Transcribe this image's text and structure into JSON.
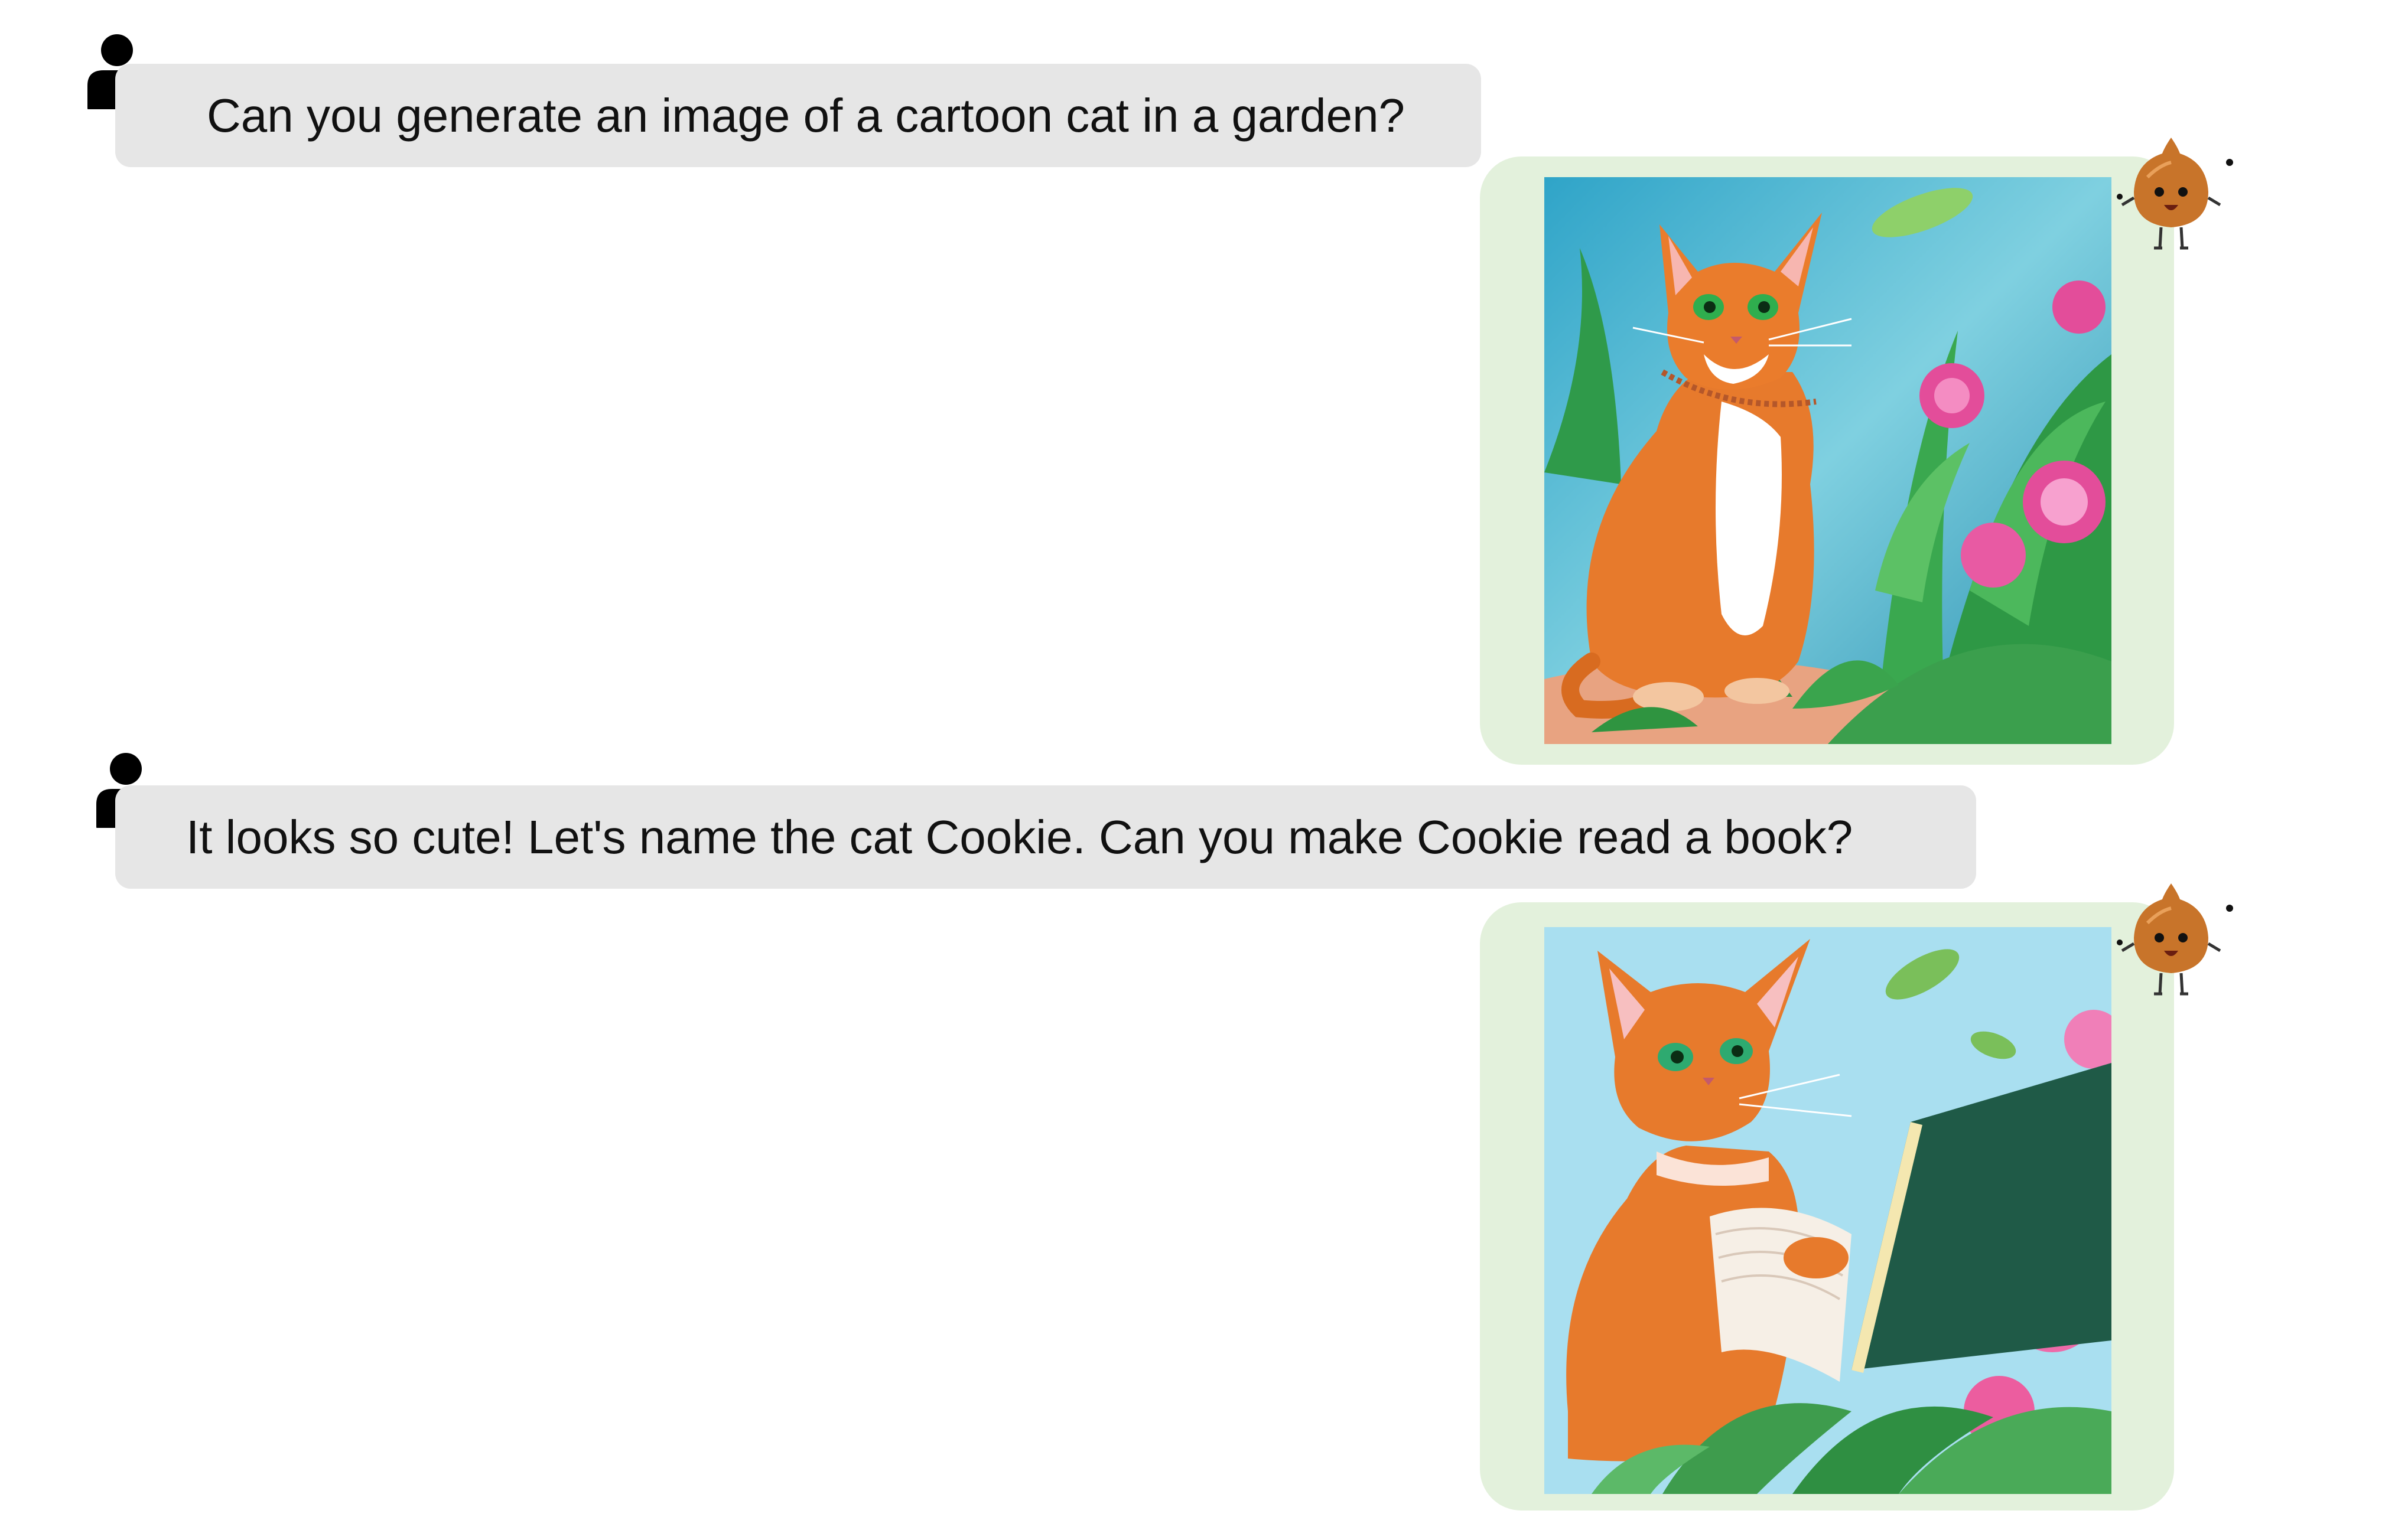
{
  "conversation": {
    "turns": [
      {
        "role": "user",
        "icon": "user-icon",
        "text": "Can you generate an image of a cartoon cat in a garden?"
      },
      {
        "role": "assistant",
        "icon": "chestnut-mascot-icon",
        "image": "orange cartoon cat sitting among green plants and pink flowers"
      },
      {
        "role": "user",
        "icon": "user-icon",
        "text": "It looks so cute! Let's name the cat Cookie. Can you make Cookie read a book?"
      },
      {
        "role": "assistant",
        "icon": "chestnut-mascot-icon",
        "image": "orange cartoon cat reading an open green book among leaves and pink flowers"
      }
    ]
  },
  "colors": {
    "user_bubble": "#e6e6e6",
    "assistant_bubble": "#e3f1dc",
    "text": "#111111"
  }
}
